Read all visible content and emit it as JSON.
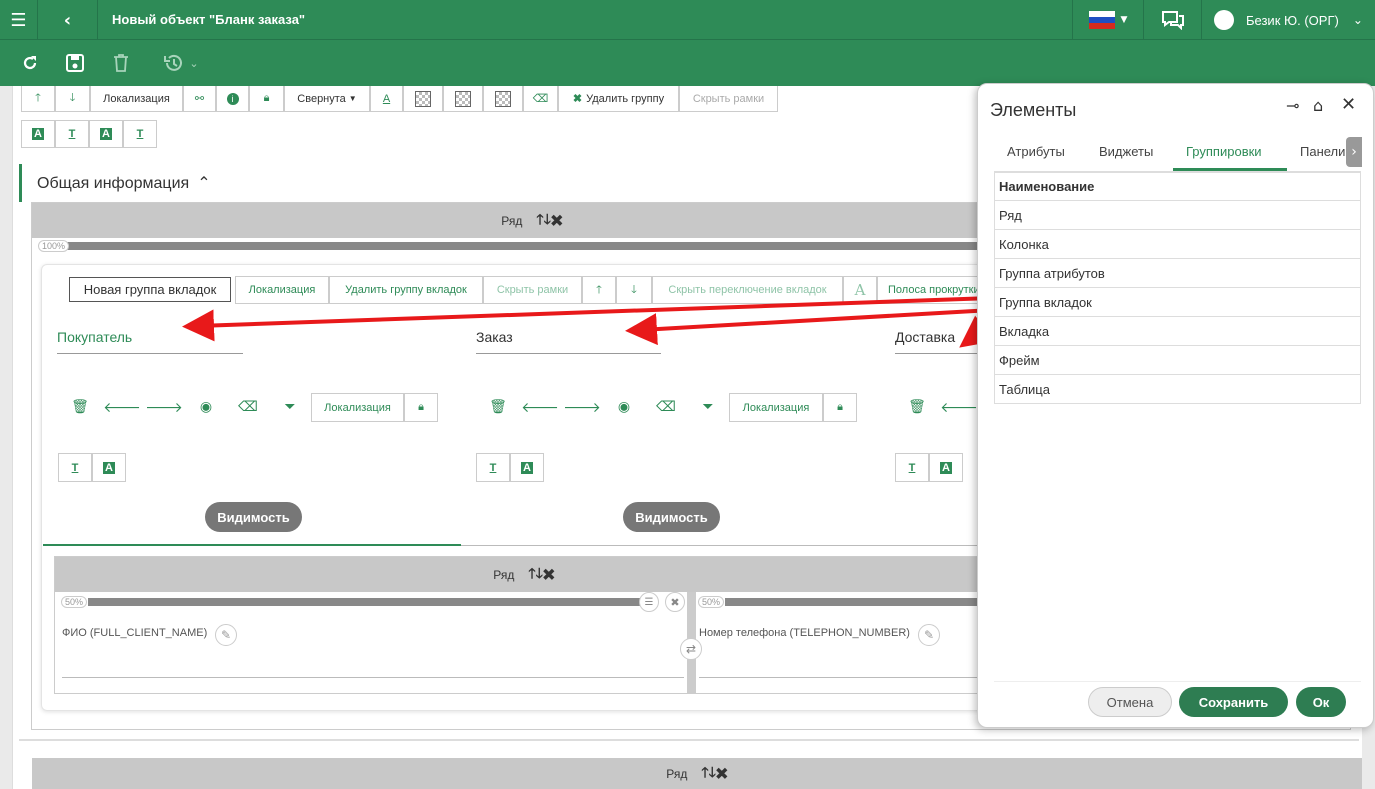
{
  "header": {
    "title": "Новый объект \"Бланк заказа\"",
    "user": "Безик Ю. (ОРГ)"
  },
  "toolbar1": {
    "localization": "Локализация",
    "collapsed": "Свернута",
    "delete_group": "Удалить группу",
    "hide_frames": "Скрыть рамки"
  },
  "section": {
    "title": "Общая информация"
  },
  "row_label": "Ряд",
  "row_pct": "100%",
  "tabgroup": {
    "name_value": "Новая группа вкладок",
    "localization": "Локализация",
    "delete_tab_group": "Удалить группу вкладок",
    "hide_frames": "Скрыть рамки",
    "hide_switch": "Скрыть переключение вкладок",
    "scroll_bar": "Полоса прокрутки"
  },
  "tabs": [
    {
      "title": "Покупатель",
      "localization": "Локализация",
      "visibility": "Видимость"
    },
    {
      "title": "Заказ",
      "localization": "Локализация",
      "visibility": "Видимость"
    },
    {
      "title": "Доставка"
    }
  ],
  "inner_row": {
    "label": "Ряд",
    "col1_pct": "50%",
    "col2_pct": "50%",
    "field1": "ФИО (FULL_CLIENT_NAME)",
    "field2": "Номер телефона (TELEPHON_NUMBER)"
  },
  "bottom_row": "Ряд",
  "panel": {
    "title": "Элементы",
    "tabs": [
      "Атрибуты",
      "Виджеты",
      "Группировки",
      "Панели"
    ],
    "active_tab": "Группировки",
    "column_header": "Наименование",
    "items": [
      "Ряд",
      "Колонка",
      "Группа атрибутов",
      "Группа вкладок",
      "Вкладка",
      "Фрейм",
      "Таблица"
    ],
    "cancel": "Отмена",
    "save": "Сохранить",
    "ok": "Ок"
  },
  "colors": {
    "brand": "#2e8b57",
    "arrow": "#e8191a"
  }
}
